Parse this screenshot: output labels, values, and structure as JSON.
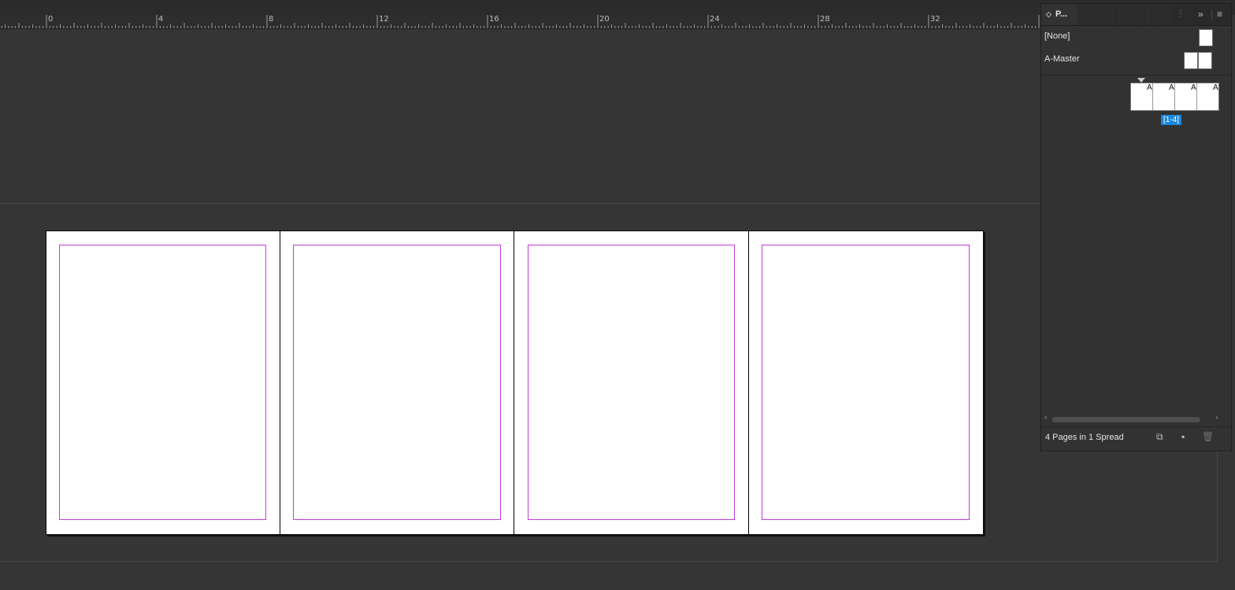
{
  "ruler": {
    "labels": [
      "0",
      "4",
      "8",
      "12",
      "16",
      "20",
      "24",
      "28",
      "32"
    ]
  },
  "panel": {
    "tab_label": "P...",
    "masters": [
      {
        "label": "[None]"
      },
      {
        "label": "A-Master"
      }
    ],
    "page_letters": [
      "A",
      "A",
      "A",
      "A"
    ],
    "spread_label": "[1-4]",
    "status_text": "4 Pages in 1 Spread",
    "icons": {
      "collapse": "double-chevron-right-icon",
      "menu": "panel-menu-icon",
      "edit_page_size": "edit-page-size-icon",
      "new_page": "new-page-icon",
      "delete": "trash-icon"
    }
  },
  "document": {
    "page_count": 4,
    "margin_color": "#c13bd6",
    "page_color": "#ffffff"
  }
}
